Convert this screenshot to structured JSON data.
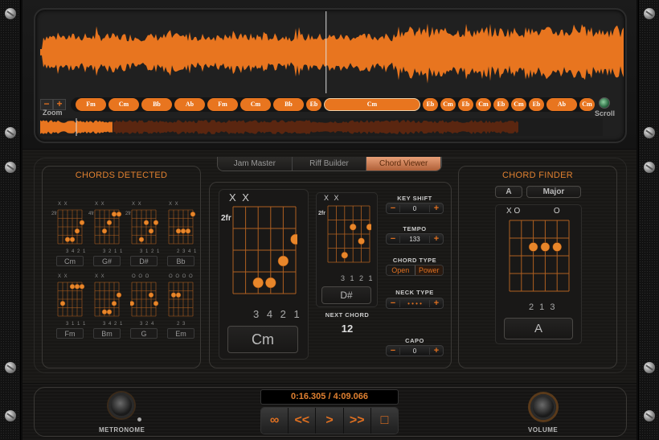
{
  "waveform": {
    "accent_color": "#e8751f",
    "zoom_label": "Zoom",
    "zoom_minus": "−",
    "zoom_plus": "+",
    "scroll_label": "Scroll",
    "playhead_position_fraction": 0.49,
    "overview_played_fraction": 0.13,
    "overview_loaded_fraction": 0.85,
    "chord_strip": [
      {
        "label": "Fm"
      },
      {
        "label": "Cm"
      },
      {
        "label": "Bb"
      },
      {
        "label": "Ab"
      },
      {
        "label": "Fm"
      },
      {
        "label": "Cm"
      },
      {
        "label": "Bb"
      },
      {
        "label": "Eb"
      },
      {
        "label": "Cm",
        "active": true
      },
      {
        "label": "Eb"
      },
      {
        "label": "Cm"
      },
      {
        "label": "Eb"
      },
      {
        "label": "Cm"
      },
      {
        "label": "Eb"
      },
      {
        "label": "Cm"
      },
      {
        "label": "Eb"
      },
      {
        "label": "Ab"
      },
      {
        "label": "Cm"
      }
    ]
  },
  "chords_detected": {
    "title": "CHORDS DETECTED",
    "chords": [
      {
        "name": "Cm",
        "top": "X X",
        "fret": "2fr",
        "fingers": "3 4 2 1"
      },
      {
        "name": "G#",
        "top": "X X",
        "fret": "4fr",
        "fingers": "3 2 1 1"
      },
      {
        "name": "D#",
        "top": "X X",
        "fret": "2fr",
        "fingers": "3 1 2 1"
      },
      {
        "name": "Bb",
        "top": "X X",
        "fret": "",
        "fingers": "2 3 4 1"
      },
      {
        "name": "Fm",
        "top": "X X",
        "fret": "",
        "fingers": "3 1 1 1"
      },
      {
        "name": "Bm",
        "top": "X X",
        "fret": "",
        "fingers": "3 4 2 1"
      },
      {
        "name": "G",
        "top": "O O O",
        "fret": "",
        "fingers": "3 2       4"
      },
      {
        "name": "Em",
        "top": "O     O O O",
        "fret": "",
        "fingers": "2 3"
      }
    ]
  },
  "tabs": [
    {
      "label": "Jam Master",
      "active": false
    },
    {
      "label": "Riff Builder",
      "active": false
    },
    {
      "label": "Chord Viewer",
      "active": true
    }
  ],
  "chord_viewer": {
    "current": {
      "name": "Cm",
      "top": "X X",
      "fret": "2fr",
      "fingers": "3 4 2 1"
    },
    "next": {
      "name": "D#",
      "top": "X X",
      "fret": "2fr",
      "fingers": "3 1 2 1"
    },
    "next_chord_label": "NEXT CHORD",
    "next_chord_count": "12",
    "controls": {
      "key_shift_label": "KEY SHIFT",
      "key_shift_value": "0",
      "tempo_label": "TEMPO",
      "tempo_value": "133",
      "chord_type_label": "CHORD TYPE",
      "chord_type_options": [
        "Open",
        "Power"
      ],
      "neck_type_label": "NECK TYPE",
      "neck_type_value": "• • • •",
      "capo_label": "CAPO",
      "capo_value": "0",
      "minus": "−",
      "plus": "+"
    }
  },
  "chord_finder": {
    "title": "CHORD FINDER",
    "root": "A",
    "quality": "Major",
    "top": "X O               O",
    "fingers": "2 1 3",
    "name": "A"
  },
  "transport": {
    "time": "0:16.305 / 4:09.066",
    "buttons": [
      {
        "name": "loop",
        "glyph": "∞"
      },
      {
        "name": "rewind",
        "glyph": "<<"
      },
      {
        "name": "play",
        "glyph": ">"
      },
      {
        "name": "fast-forward",
        "glyph": ">>"
      },
      {
        "name": "stop",
        "glyph": "□"
      }
    ],
    "metronome_label": "METRONOME",
    "volume_label": "VOLUME"
  }
}
